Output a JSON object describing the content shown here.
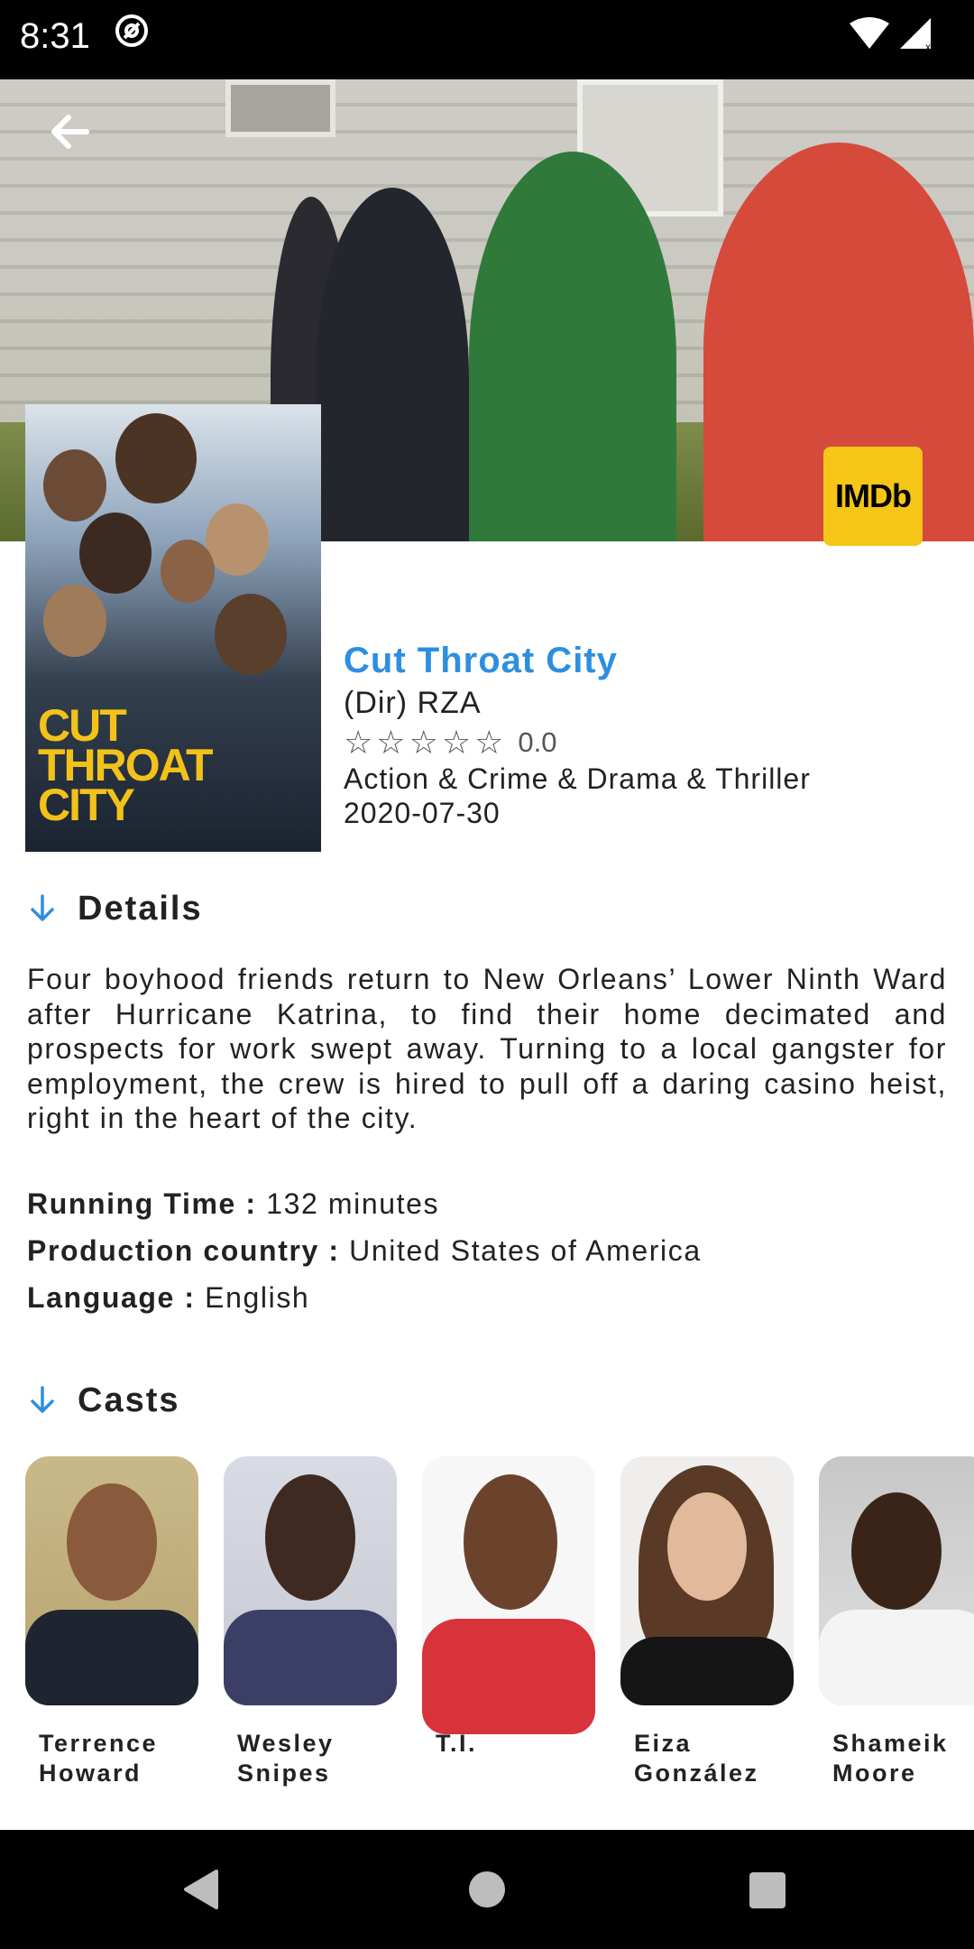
{
  "status_bar": {
    "time": "8:31"
  },
  "hero": {
    "back_label": "Back",
    "imdb_label": "IMDb"
  },
  "poster": {
    "title": "CUT\nTHROAT\nCITY"
  },
  "movie": {
    "title": "Cut Throat City",
    "director": "(Dir) RZA",
    "rating": "0.0",
    "stars_total": 5,
    "stars_filled": 0,
    "genres": "Action & Crime & Drama & Thriller",
    "release_date": "2020-07-30"
  },
  "details": {
    "heading": "Details",
    "overview": "Four boyhood friends return to New Orleans’ Lower Ninth Ward after Hurricane Katrina, to find their home decimated and prospects for work swept away. Turning to a local gangster for employment, the crew is hired to pull off a daring casino heist, right in the heart of the city.",
    "running_time_label": "Running Time :",
    "running_time_value": "132 minutes",
    "country_label": "Production country :",
    "country_value": "United States of America",
    "language_label": "Language :",
    "language_value": "English"
  },
  "casts": {
    "heading": "Casts",
    "items": [
      {
        "name": "Terrence\nHoward"
      },
      {
        "name": "Wesley\nSnipes"
      },
      {
        "name": "T.I."
      },
      {
        "name": "Eiza\nGonzález"
      },
      {
        "name": "Shameik\nMoore"
      }
    ]
  },
  "colors": {
    "accent": "#2d8fe0",
    "imdb": "#f5c518",
    "text": "#222222"
  },
  "icons": [
    "back-arrow-icon",
    "star-outline-icon",
    "arrow-down-icon",
    "wifi-icon",
    "signal-icon",
    "nav-back-icon",
    "nav-home-icon",
    "nav-recents-icon"
  ]
}
